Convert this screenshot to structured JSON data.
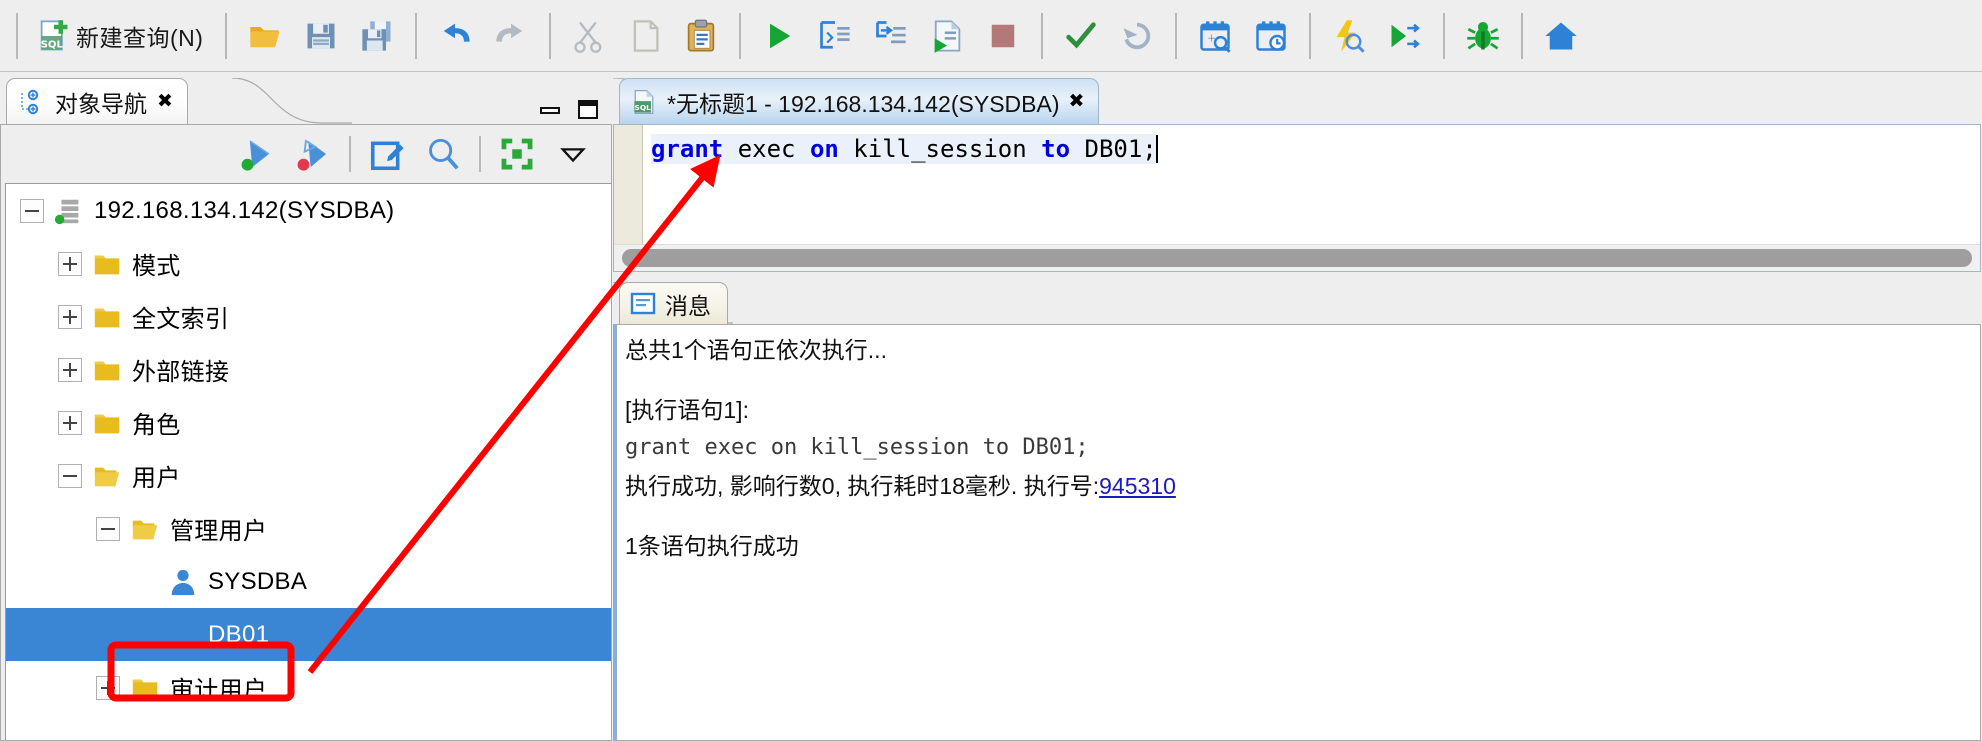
{
  "toolbar": {
    "new_query_label": "新建查询(N)",
    "buttons": [
      {
        "name": "new-query",
        "icon": "sql-new-icon",
        "label": "新建查询(N)"
      },
      {
        "name": "open-file",
        "icon": "folder-open-icon",
        "label": ""
      },
      {
        "name": "save",
        "icon": "save-icon",
        "label": ""
      },
      {
        "name": "save-as",
        "icon": "save-as-icon",
        "label": ""
      },
      {
        "name": "undo",
        "icon": "undo-icon",
        "label": ""
      },
      {
        "name": "redo",
        "icon": "redo-icon",
        "label": ""
      },
      {
        "name": "cut",
        "icon": "scissors-icon",
        "label": ""
      },
      {
        "name": "copy",
        "icon": "copy-icon",
        "label": ""
      },
      {
        "name": "paste",
        "icon": "clipboard-paste-icon",
        "label": ""
      },
      {
        "name": "execute",
        "icon": "play-green-icon",
        "label": ""
      },
      {
        "name": "execute-step",
        "icon": "execute-step-icon",
        "label": ""
      },
      {
        "name": "execute-into",
        "icon": "execute-into-icon",
        "label": ""
      },
      {
        "name": "execute-script",
        "icon": "execute-script-icon",
        "label": ""
      },
      {
        "name": "stop",
        "icon": "stop-red-icon",
        "label": ""
      },
      {
        "name": "check-syntax",
        "icon": "checkmark-icon",
        "label": ""
      },
      {
        "name": "rollback",
        "icon": "rollback-icon",
        "label": ""
      },
      {
        "name": "plan-analyze",
        "icon": "calendar-search-icon",
        "label": ""
      },
      {
        "name": "schedule",
        "icon": "calendar-clock-icon",
        "label": ""
      },
      {
        "name": "explain-plan",
        "icon": "lightning-search-icon",
        "label": ""
      },
      {
        "name": "run-to-cursor",
        "icon": "play-arrows-icon",
        "label": ""
      },
      {
        "name": "debug",
        "icon": "bug-icon",
        "label": ""
      },
      {
        "name": "home",
        "icon": "home-icon",
        "label": ""
      }
    ]
  },
  "left_panel": {
    "tab": {
      "title": "对象导航",
      "icon": "object-navigator-icon",
      "close_glyph": "✖"
    },
    "window_controls": {
      "minimize": "minimize",
      "maximize": "maximize"
    },
    "nav_toolbar": [
      {
        "name": "connect",
        "icon": "connect-green-icon"
      },
      {
        "name": "disconnect",
        "icon": "disconnect-red-icon"
      },
      {
        "name": "edit-object",
        "icon": "edit-pencil-icon"
      },
      {
        "name": "search-object",
        "icon": "magnifier-icon"
      },
      {
        "name": "collapse-all",
        "icon": "collapse-all-green-icon"
      },
      {
        "name": "view-menu",
        "icon": "chevron-down-icon"
      }
    ],
    "tree": [
      {
        "label": "192.168.134.142(SYSDBA)",
        "icon": "server-icon",
        "state": "expanded",
        "depth": 0,
        "selected": false
      },
      {
        "label": "模式",
        "icon": "folder-icon",
        "state": "collapsed",
        "depth": 1,
        "selected": false
      },
      {
        "label": "全文索引",
        "icon": "folder-icon",
        "state": "collapsed",
        "depth": 1,
        "selected": false
      },
      {
        "label": "外部链接",
        "icon": "folder-icon",
        "state": "collapsed",
        "depth": 1,
        "selected": false
      },
      {
        "label": "角色",
        "icon": "folder-icon",
        "state": "collapsed",
        "depth": 1,
        "selected": false
      },
      {
        "label": "用户",
        "icon": "folder-open-icon",
        "state": "expanded",
        "depth": 1,
        "selected": false
      },
      {
        "label": "管理用户",
        "icon": "folder-open-icon",
        "state": "expanded",
        "depth": 2,
        "selected": false
      },
      {
        "label": "SYSDBA",
        "icon": "user-icon",
        "state": "leaf",
        "depth": 3,
        "selected": false
      },
      {
        "label": "DB01",
        "icon": "user-icon",
        "state": "leaf",
        "depth": 3,
        "selected": true
      },
      {
        "label": "审计用户",
        "icon": "folder-icon",
        "state": "collapsed",
        "depth": 2,
        "selected": false
      }
    ]
  },
  "editor": {
    "tab": {
      "title": "*无标题1 - 192.168.134.142(SYSDBA)",
      "icon": "sql-file-icon",
      "close_glyph": "✖"
    },
    "code": {
      "tokens": [
        {
          "t": "grant",
          "kw": true
        },
        {
          "t": " exec ",
          "kw": false
        },
        {
          "t": "on",
          "kw": true
        },
        {
          "t": " kill_session ",
          "kw": false
        },
        {
          "t": "to",
          "kw": true
        },
        {
          "t": " DB01;",
          "kw": false
        }
      ],
      "plain": "grant exec on kill_session to DB01;"
    }
  },
  "messages": {
    "tab": {
      "title": "消息",
      "icon": "message-lines-icon"
    },
    "lines": [
      {
        "text": "总共1个语句正依次执行...",
        "style": "normal"
      },
      {
        "text": "",
        "style": "blank"
      },
      {
        "text": "[执行语句1]:",
        "style": "normal"
      },
      {
        "text": "grant exec on kill_session to DB01;",
        "style": "mono"
      },
      {
        "text": "执行成功, 影响行数0, 执行耗时18毫秒. 执行号:",
        "style": "link-line",
        "link": "945310"
      },
      {
        "text": "",
        "style": "blank"
      },
      {
        "text": "1条语句执行成功",
        "style": "normal"
      }
    ]
  },
  "annotation": {
    "highlight_box": "DB01",
    "arrow_color": "#ff0000",
    "arrow_from": "DB01 tree node",
    "arrow_to": "SQL editor statement"
  },
  "colors": {
    "selection_blue": "#3a86d4",
    "keyword_blue": "#0000dd",
    "annotation_red": "#ff0000",
    "link_blue": "#1a1ac0",
    "chrome_gray": "#eeeeee"
  }
}
